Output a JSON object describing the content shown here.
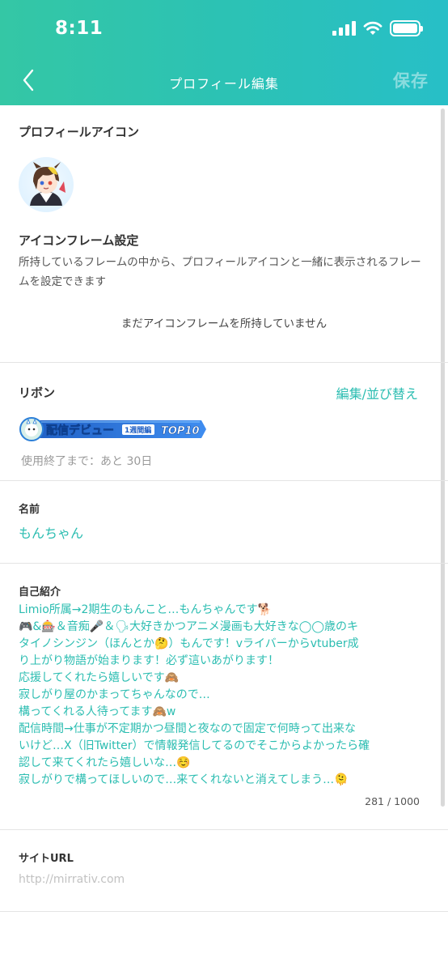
{
  "status_bar": {
    "time": "8:11"
  },
  "nav": {
    "title": "プロフィール編集",
    "save_label": "保存"
  },
  "profile_icon": {
    "heading": "プロフィールアイコン"
  },
  "icon_frame": {
    "heading": "アイコンフレーム設定",
    "description": "所持しているフレームの中から、プロフィールアイコンと一緒に表示されるフレームを設定できます",
    "empty_message": "まだアイコンフレームを所持していません"
  },
  "ribbon": {
    "heading": "リボン",
    "edit_label": "編集/並び替え",
    "badge_text": "配信デビュー",
    "badge_period": "1週間編",
    "badge_rank": "TOP10",
    "remaining": "使用終了まで：あと 30日"
  },
  "name": {
    "label": "名前",
    "value": "もんちゃん"
  },
  "bio": {
    "label": "自己紹介",
    "lines": [
      "Limio所属→2期生のもんこと…もんちゃんです🐕",
      "🎮&🎰＆音痴🎤＆🗣大好きかつアニメ漫画も大好きな◯◯歳のキ",
      "タイノシンジン（ほんとか🤔）もんです！vライバーからvtuber成",
      "り上がり物語が始まります！必ず這いあがります！",
      "応援してくれたら嬉しいです🙈",
      "寂しがり屋のかまってちゃんなので…",
      "構ってくれる人待ってます🙈w",
      "配信時間→仕事が不定期かつ昼間と夜なので固定で何時って出来な",
      "いけど…X（旧Twitter）で情報発信してるのでそこからよかったら確",
      "認して来てくれたら嬉しいな…☺️",
      "寂しがりで構ってほしいので…来てくれないと消えてしまう…🫠"
    ],
    "counter": "281 / 1000"
  },
  "site_url": {
    "label": "サイトURL",
    "placeholder": "http://mirrativ.com"
  },
  "colors": {
    "accent": "#2bbdb1",
    "header_start": "#34c7a5",
    "header_end": "#27bfc7"
  }
}
